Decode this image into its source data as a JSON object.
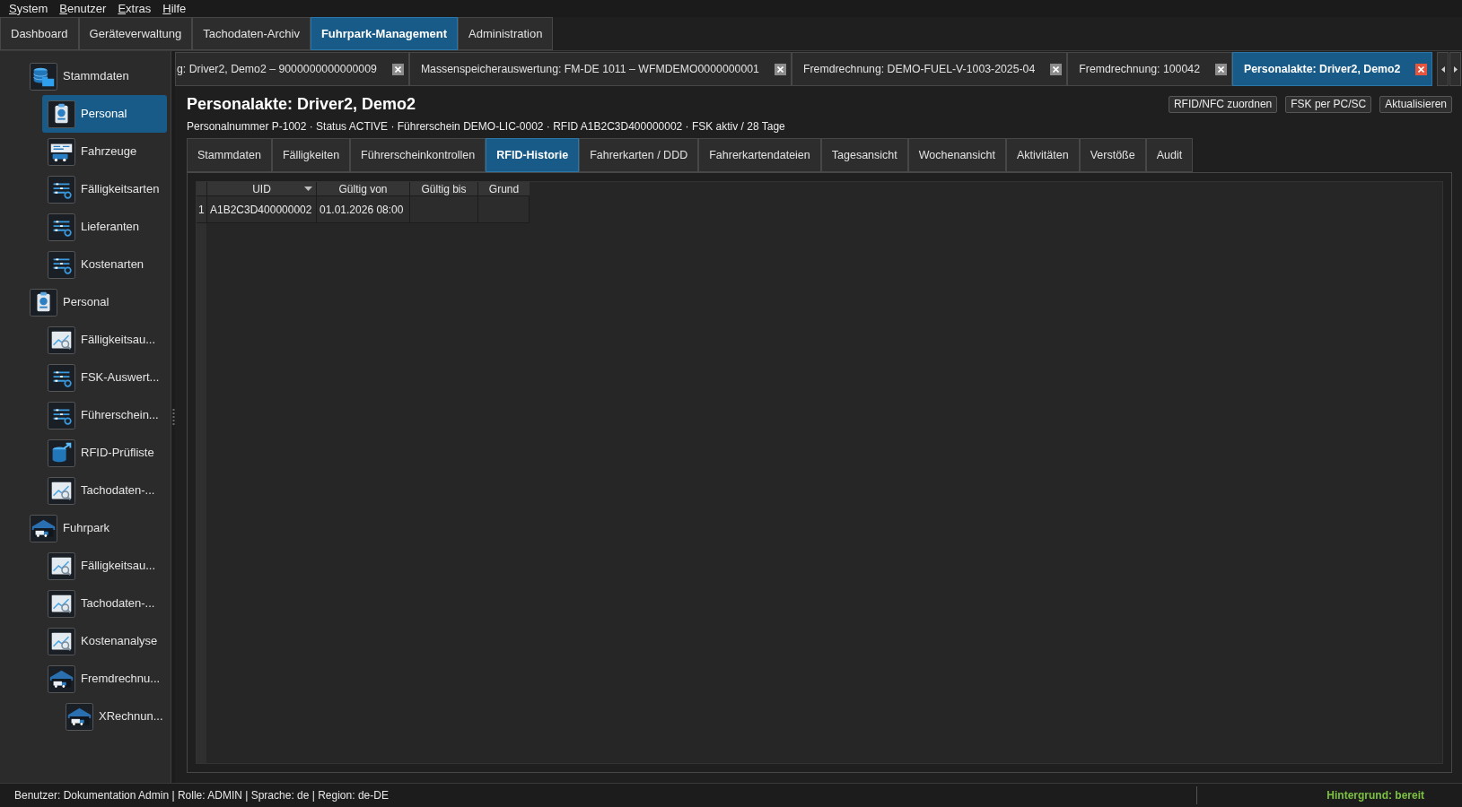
{
  "menu_bar": [
    "System",
    "Benutzer",
    "Extras",
    "Hilfe"
  ],
  "main_tabs": [
    {
      "label": "Dashboard",
      "selected": false
    },
    {
      "label": "Geräteverwaltung",
      "selected": false
    },
    {
      "label": "Tachodaten-Archiv",
      "selected": false
    },
    {
      "label": "Fuhrpark-Management",
      "selected": true
    },
    {
      "label": "Administration",
      "selected": false
    }
  ],
  "sidebar": {
    "items": [
      {
        "label": "Stammdaten",
        "kind": "database",
        "selected": false,
        "children": [
          {
            "label": "Personal",
            "kind": "badge",
            "selected": true
          },
          {
            "label": "Fahrzeuge",
            "kind": "vehicles",
            "selected": false
          },
          {
            "label": "Fälligkeitsarten",
            "kind": "list",
            "selected": false
          },
          {
            "label": "Lieferanten",
            "kind": "list",
            "selected": false
          },
          {
            "label": "Kostenarten",
            "kind": "list",
            "selected": false
          }
        ]
      },
      {
        "label": "Personal",
        "kind": "badge",
        "selected": false,
        "children": [
          {
            "label": "Fälligkeitsau...",
            "kind": "chart",
            "selected": false
          },
          {
            "label": "FSK-Auswert...",
            "kind": "list",
            "selected": false
          },
          {
            "label": "Führerschein...",
            "kind": "list",
            "selected": false
          },
          {
            "label": "RFID-Prüfliste",
            "kind": "export",
            "selected": false
          },
          {
            "label": "Tachodaten-...",
            "kind": "chart",
            "selected": false
          }
        ]
      },
      {
        "label": "Fuhrpark",
        "kind": "garage",
        "selected": false,
        "children": [
          {
            "label": "Fälligkeitsau...",
            "kind": "chart",
            "selected": false
          },
          {
            "label": "Tachodaten-...",
            "kind": "chart",
            "selected": false
          },
          {
            "label": "Kostenanalyse",
            "kind": "chart",
            "selected": false
          },
          {
            "label": "Fremdrechnu...",
            "kind": "garage",
            "selected": false,
            "children": [
              {
                "label": "XRechnun...",
                "kind": "garage",
                "selected": false
              }
            ]
          }
        ]
      }
    ]
  },
  "document_tabs": [
    {
      "label": "g: Driver2, Demo2 – 9000000000000009",
      "selected": false
    },
    {
      "label": "Massenspeicherauswertung: FM-DE 1011 – WFMDEMO0000000001",
      "selected": false
    },
    {
      "label": "Fremdrechnung: DEMO-FUEL-V-1003-2025-04",
      "selected": false
    },
    {
      "label": "Fremdrechnung: 100042",
      "selected": false
    },
    {
      "label": "Personalakte: Driver2, Demo2",
      "selected": true
    }
  ],
  "header": {
    "title": "Personalakte: Driver2, Demo2",
    "subtitle": "Personalnummer P-1002 · Status ACTIVE · Führerschein DEMO-LIC-0002 · RFID A1B2C3D400000002 · FSK aktiv / 28 Tage",
    "buttons": [
      "RFID/NFC zuordnen",
      "FSK per PC/SC",
      "Aktualisieren"
    ]
  },
  "detail_tabs": [
    {
      "label": "Stammdaten",
      "selected": false
    },
    {
      "label": "Fälligkeiten",
      "selected": false
    },
    {
      "label": "Führerscheinkontrollen",
      "selected": false
    },
    {
      "label": "RFID-Historie",
      "selected": true
    },
    {
      "label": "Fahrerkarten / DDD",
      "selected": false
    },
    {
      "label": "Fahrerkartendateien",
      "selected": false
    },
    {
      "label": "Tagesansicht",
      "selected": false
    },
    {
      "label": "Wochenansicht",
      "selected": false
    },
    {
      "label": "Aktivitäten",
      "selected": false
    },
    {
      "label": "Verstöße",
      "selected": false
    },
    {
      "label": "Audit",
      "selected": false
    }
  ],
  "table": {
    "columns": [
      {
        "label": "UID",
        "sorted": true
      },
      {
        "label": "Gültig von",
        "sorted": false
      },
      {
        "label": "Gültig bis",
        "sorted": false
      },
      {
        "label": "Grund",
        "sorted": false
      }
    ],
    "rows": [
      {
        "number": "1",
        "cells": [
          "A1B2C3D400000002",
          "01.01.2026 08:00"
        ]
      }
    ]
  },
  "status_bar": {
    "left": "Benutzer: Dokumentation Admin | Rolle: ADMIN | Sprache: de | Region: de-DE",
    "right": "Hintergrund: bereit"
  }
}
